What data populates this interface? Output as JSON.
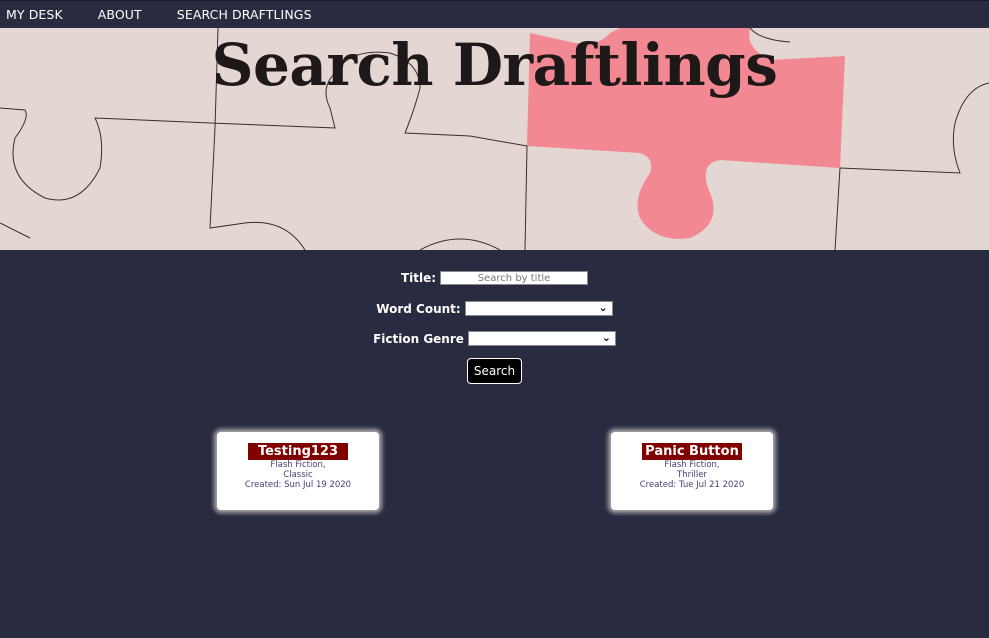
{
  "nav": {
    "items": [
      {
        "label": "MY DESK"
      },
      {
        "label": "ABOUT"
      },
      {
        "label": "SEARCH DRAFTLINGS"
      }
    ]
  },
  "hero": {
    "title": "Search Draftlings",
    "background": "puzzle pieces image with pink missing piece"
  },
  "form": {
    "title_label": "Title:",
    "title_placeholder": "Search by title",
    "title_value": "",
    "word_count_label": "Word Count:",
    "word_count_value": "",
    "genre_label": "Fiction Genre",
    "genre_value": "",
    "search_button": "Search"
  },
  "results": [
    {
      "title": "Testing123",
      "form": "Flash Fiction,",
      "genre": "Classic",
      "created": "Created: Sun Jul 19 2020"
    },
    {
      "title": "Panic Button",
      "form": "Flash Fiction,",
      "genre": "Thriller",
      "created": "Created: Tue Jul 21 2020"
    }
  ],
  "colors": {
    "background": "#292b41",
    "title_badge": "#800000",
    "meta_text": "#4d3c74",
    "puzzle_pink": "#f48a92"
  }
}
